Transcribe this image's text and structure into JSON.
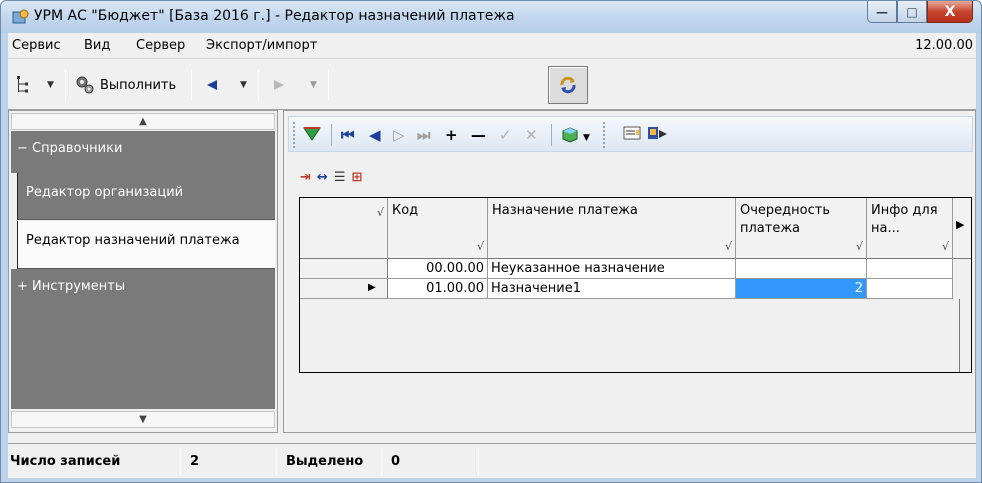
{
  "window": {
    "title": "УРМ АС \"Бюджет\" [База 2016 г.] - Редактор назначений платежа",
    "minimize_glyph": "—",
    "maximize_glyph": "□",
    "close_glyph": "X"
  },
  "menu": {
    "items": [
      "Сервис",
      "Вид",
      "Сервер",
      "Экспорт/импорт"
    ],
    "version": "12.00.00"
  },
  "toolbar": {
    "execute_label": "Выполнить"
  },
  "nav": {
    "groups": [
      {
        "sign": "−",
        "label": "Справочники"
      },
      {
        "sign": "+",
        "label": "Инструменты"
      }
    ],
    "items": [
      {
        "label": "Редактор организаций",
        "selected": false
      },
      {
        "label": "Редактор назначений платежа",
        "selected": true
      }
    ]
  },
  "grid": {
    "columns": [
      "Код",
      "Назначение платежа",
      "Очередность платежа",
      "Инфо для на..."
    ],
    "rows": [
      {
        "code": "00.00.00",
        "purpose": "Неуказанное назначение",
        "priority": "",
        "info": "",
        "current": false
      },
      {
        "code": "01.00.00",
        "purpose": "Назначение1",
        "priority": "2",
        "info": "",
        "current": true
      }
    ]
  },
  "status": {
    "records_label": "Число записей",
    "records_count": "2",
    "selected_label": "Выделено",
    "selected_count": "0"
  },
  "colors": {
    "selection": "#3399ff",
    "nav_group_bg": "#7a7a7a",
    "title_bar": "#c2d7ee"
  },
  "icons": [
    "app-icon",
    "tree-icon",
    "execute-gear-icon",
    "back-arrow-icon",
    "forward-arrow-icon",
    "refresh-icon",
    "filter-icon",
    "first-record-icon",
    "prev-record-icon",
    "next-record-icon",
    "last-record-icon",
    "add-icon",
    "delete-icon",
    "confirm-icon",
    "cancel-icon",
    "cube-icon",
    "report-icon",
    "export-icon"
  ]
}
